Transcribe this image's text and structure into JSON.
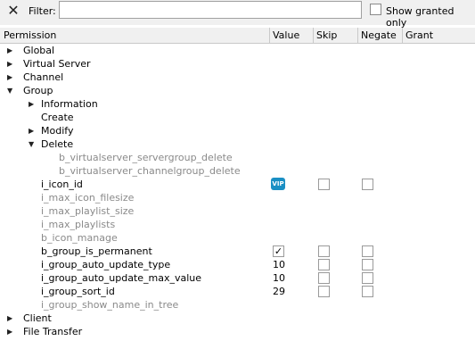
{
  "filter": {
    "label": "Filter:",
    "value": "",
    "show_granted_label": "Show granted only",
    "show_granted_checked": false
  },
  "header": {
    "permission": "Permission",
    "value": "Value",
    "skip": "Skip",
    "negate": "Negate",
    "grant": "Grant"
  },
  "tree": [
    {
      "label": "Global",
      "indent": 0,
      "arrow": "collapsed",
      "muted": false
    },
    {
      "label": "Virtual Server",
      "indent": 0,
      "arrow": "collapsed",
      "muted": false
    },
    {
      "label": "Channel",
      "indent": 0,
      "arrow": "collapsed",
      "muted": false
    },
    {
      "label": "Group",
      "indent": 0,
      "arrow": "expanded",
      "muted": false
    },
    {
      "label": "Information",
      "indent": 1,
      "arrow": "collapsed",
      "muted": false
    },
    {
      "label": "Create",
      "indent": 1,
      "arrow": "none",
      "muted": false
    },
    {
      "label": "Modify",
      "indent": 1,
      "arrow": "collapsed",
      "muted": false
    },
    {
      "label": "Delete",
      "indent": 1,
      "arrow": "expanded",
      "muted": false
    },
    {
      "label": "b_virtualserver_servergroup_delete",
      "indent": 3,
      "arrow": "none",
      "muted": true
    },
    {
      "label": "b_virtualserver_channelgroup_delete",
      "indent": 3,
      "arrow": "none",
      "muted": true
    },
    {
      "label": "i_icon_id",
      "indent": 2,
      "arrow": "none",
      "muted": false,
      "value_icon": "vip-icon",
      "value_icon_text": "VIP",
      "skip": false,
      "negate": false
    },
    {
      "label": "i_max_icon_filesize",
      "indent": 2,
      "arrow": "none",
      "muted": true
    },
    {
      "label": "i_max_playlist_size",
      "indent": 2,
      "arrow": "none",
      "muted": true
    },
    {
      "label": "i_max_playlists",
      "indent": 2,
      "arrow": "none",
      "muted": true
    },
    {
      "label": "b_icon_manage",
      "indent": 2,
      "arrow": "none",
      "muted": true
    },
    {
      "label": "b_group_is_permanent",
      "indent": 2,
      "arrow": "none",
      "muted": false,
      "value_check": true,
      "skip": false,
      "negate": false
    },
    {
      "label": "i_group_auto_update_type",
      "indent": 2,
      "arrow": "none",
      "muted": false,
      "value": "10",
      "skip": false,
      "negate": false
    },
    {
      "label": "i_group_auto_update_max_value",
      "indent": 2,
      "arrow": "none",
      "muted": false,
      "value": "10",
      "skip": false,
      "negate": false
    },
    {
      "label": "i_group_sort_id",
      "indent": 2,
      "arrow": "none",
      "muted": false,
      "value": "29",
      "skip": false,
      "negate": false
    },
    {
      "label": "i_group_show_name_in_tree",
      "indent": 2,
      "arrow": "none",
      "muted": true
    },
    {
      "label": "Client",
      "indent": 0,
      "arrow": "collapsed",
      "muted": false
    },
    {
      "label": "File Transfer",
      "indent": 0,
      "arrow": "collapsed",
      "muted": false
    }
  ]
}
